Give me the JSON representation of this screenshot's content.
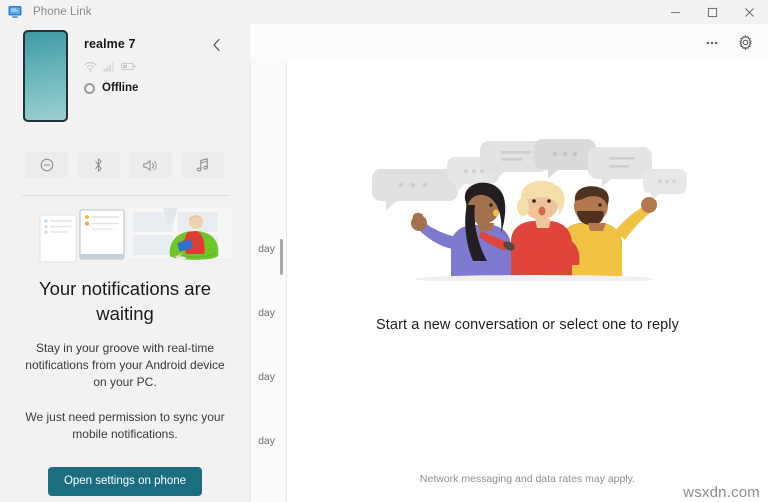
{
  "window": {
    "app_title": "Phone Link",
    "app_icon": "phone-link-icon",
    "minimize_label": "─",
    "maximize_label": "□",
    "close_label": "✕"
  },
  "topbar": {
    "more_label": "⋯",
    "more_icon": "more-options-icon",
    "settings_icon": "gear-icon"
  },
  "device": {
    "name": "realme 7",
    "status": "Offline",
    "status_icon": "offline-circle-icon",
    "signal_icons": [
      "wifi-icon",
      "cellular-signal-icon",
      "battery-icon"
    ],
    "back_icon": "chevron-left-icon",
    "thumbnail_icon": "phone-thumbnail",
    "thumbnail_color_top": "#3f9aa6",
    "thumbnail_color_bottom": "#9ccfd0"
  },
  "quick_actions": [
    {
      "name": "do-not-disturb-toggle",
      "icon": "do-not-disturb-icon",
      "label": "Do not disturb"
    },
    {
      "name": "bluetooth-toggle",
      "icon": "bluetooth-icon",
      "label": "Bluetooth"
    },
    {
      "name": "volume-toggle",
      "icon": "volume-icon",
      "label": "Volume"
    },
    {
      "name": "music-toggle",
      "icon": "music-note-icon",
      "label": "Music"
    }
  ],
  "notifications_panel": {
    "illustration": "notifications-illustration",
    "title": "Your notifications are waiting",
    "body": "Stay in your groove with real-time notifications from your Android device on your PC.",
    "body2": "We just need permission to sync your mobile notifications.",
    "cta_label": "Open settings on phone",
    "cta_color": "#1b6d80"
  },
  "conversation_list": {
    "days": [
      "day",
      "day",
      "day",
      "day"
    ]
  },
  "messages": {
    "illustration": "three-people-chatting-illustration",
    "empty_state": "Start a new conversation or select one to reply",
    "footer_note": "Network messaging and data rates may apply."
  },
  "watermark": {
    "text": "wsxdn.com"
  }
}
